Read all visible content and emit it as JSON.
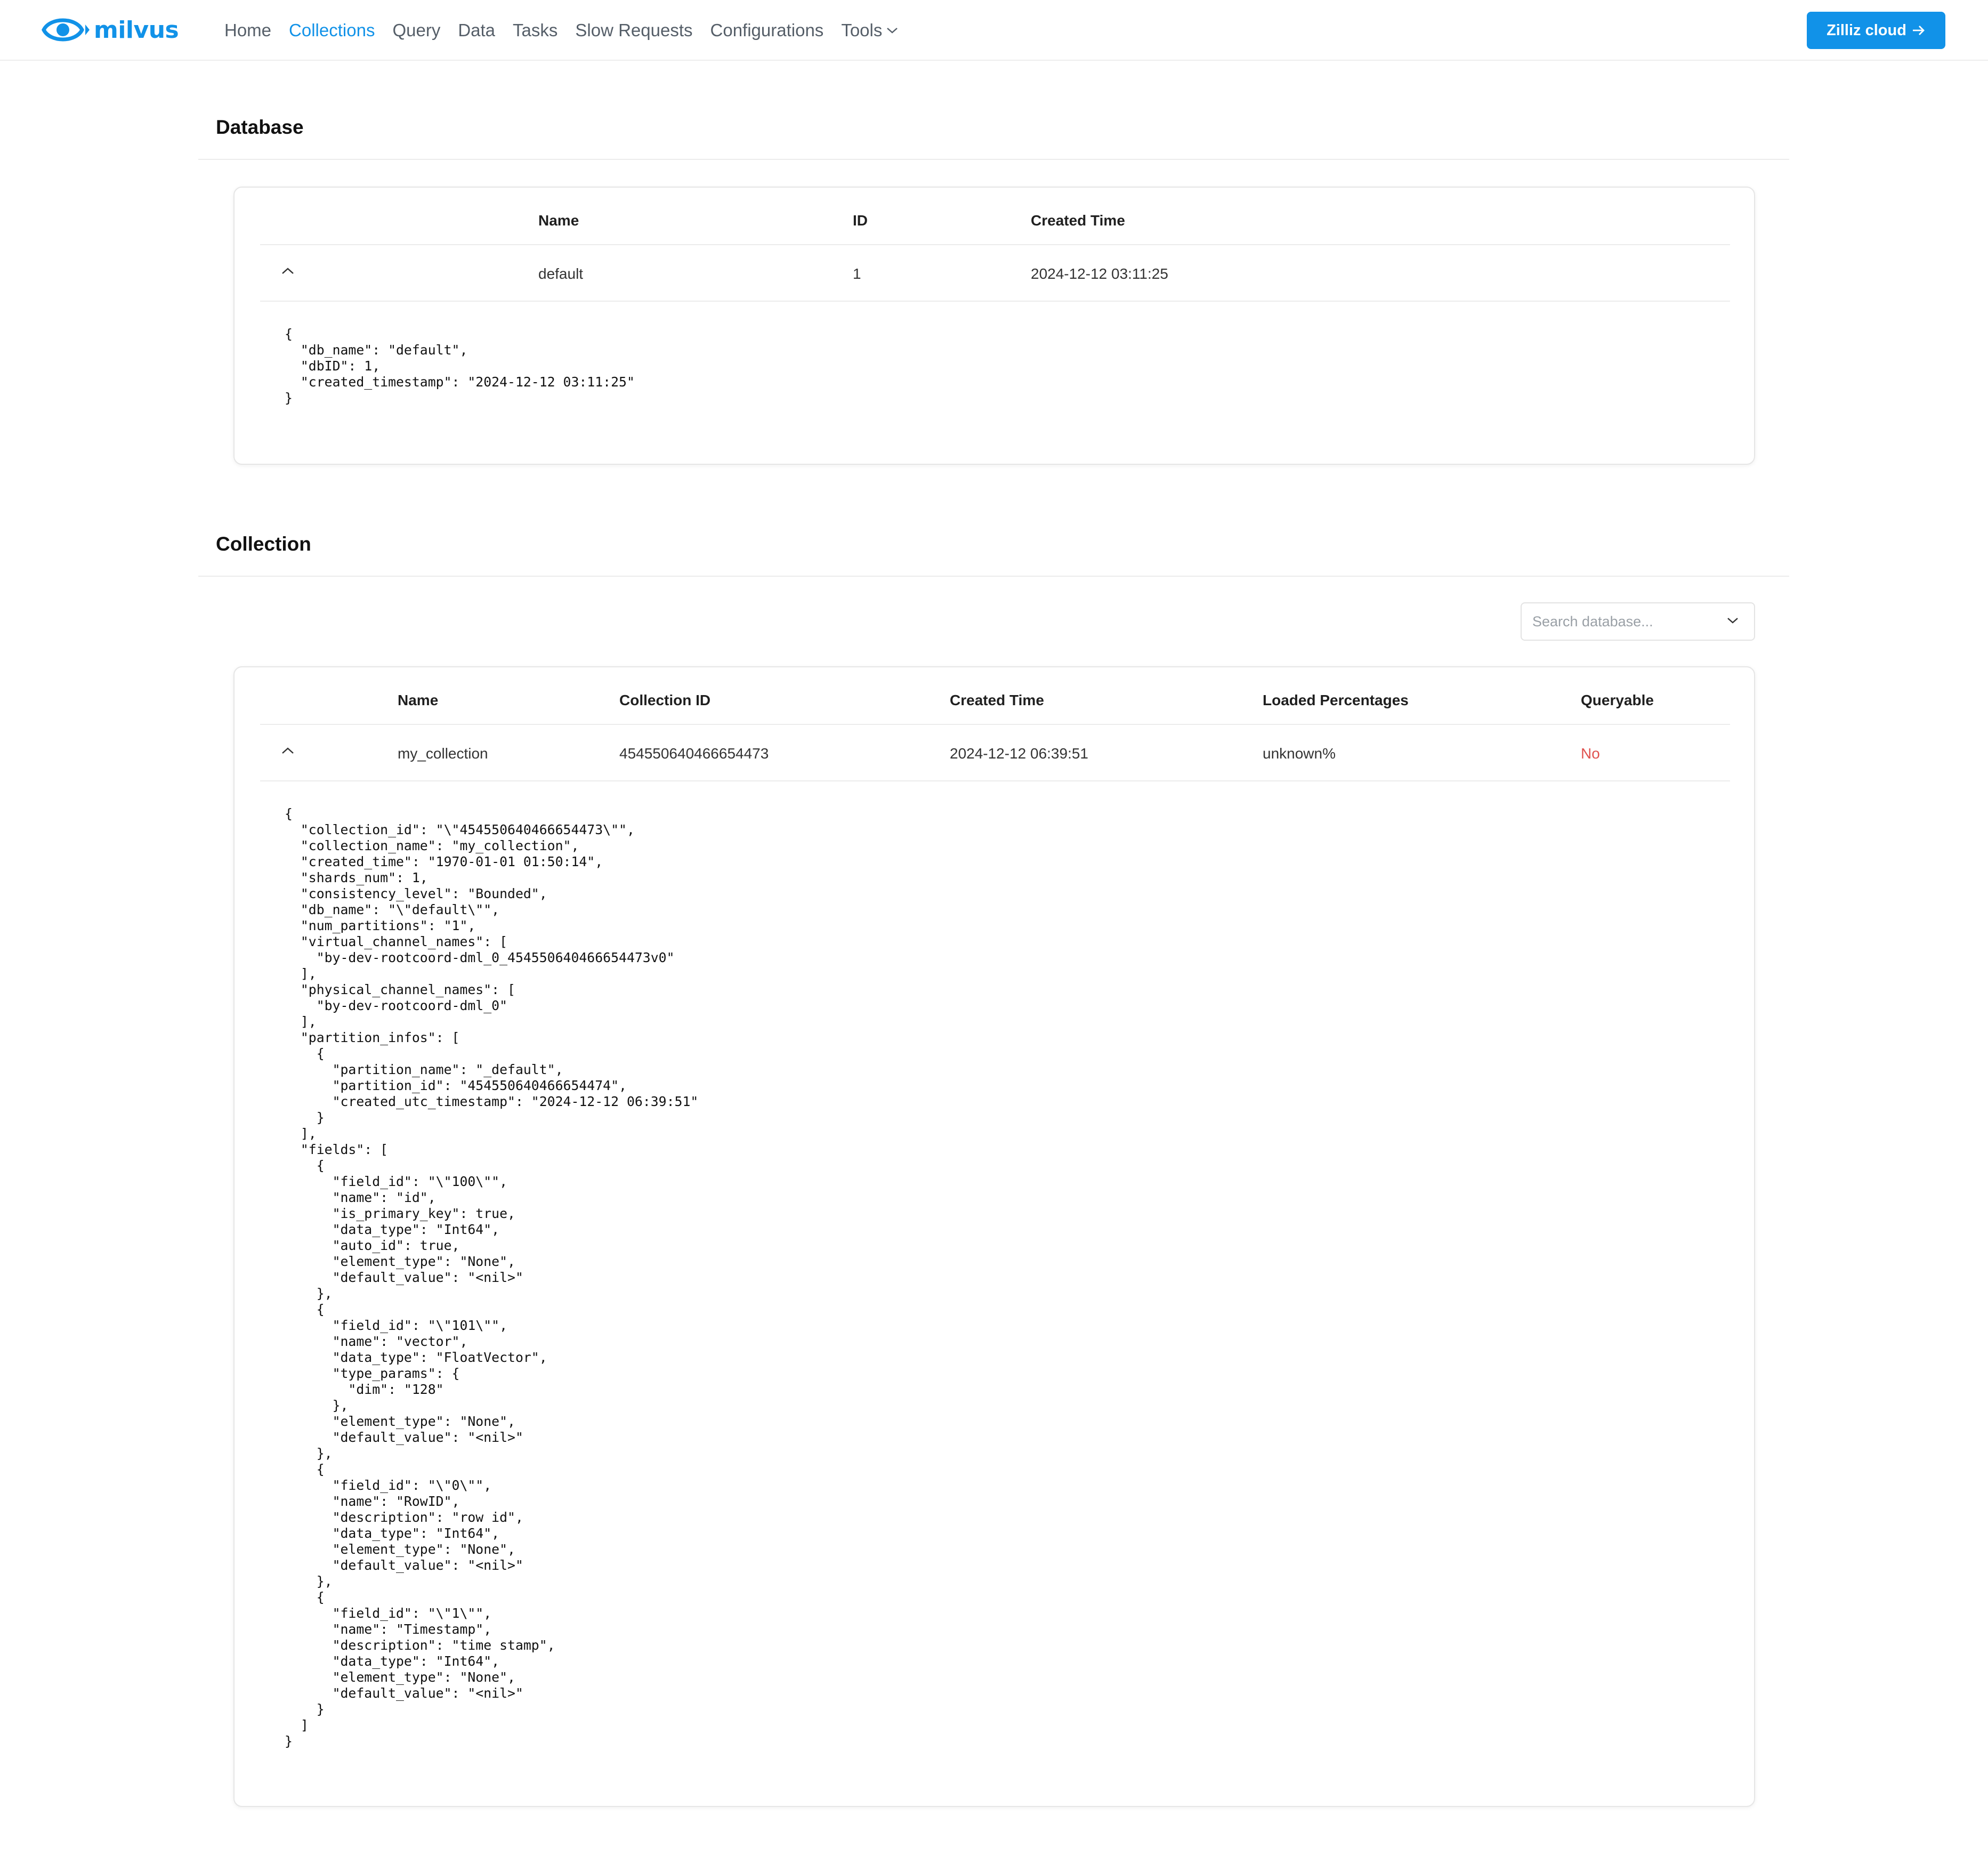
{
  "app": {
    "logo_text": "milvus"
  },
  "nav": {
    "items": [
      "Home",
      "Collections",
      "Query",
      "Data",
      "Tasks",
      "Slow Requests",
      "Configurations"
    ],
    "tools_label": "Tools",
    "active": "Collections"
  },
  "cta": {
    "label": "Zilliz cloud"
  },
  "database_section": {
    "title": "Database",
    "columns": [
      "Name",
      "ID",
      "Created Time"
    ],
    "rows": [
      {
        "name": "default",
        "id": "1",
        "created_time": "2024-12-12 03:11:25"
      }
    ],
    "detail_json": "{\n  \"db_name\": \"default\",\n  \"dbID\": 1,\n  \"created_timestamp\": \"2024-12-12 03:11:25\"\n}"
  },
  "collection_section": {
    "title": "Collection",
    "search": {
      "placeholder": "Search database..."
    },
    "columns": [
      "Name",
      "Collection ID",
      "Created Time",
      "Loaded Percentages",
      "Queryable"
    ],
    "rows": [
      {
        "name": "my_collection",
        "collection_id": "454550640466654473",
        "created_time": "2024-12-12 06:39:51",
        "loaded_percentage": "unknown%",
        "queryable": "No"
      }
    ],
    "detail_json": "{\n  \"collection_id\": \"\\\"454550640466654473\\\"\",\n  \"collection_name\": \"my_collection\",\n  \"created_time\": \"1970-01-01 01:50:14\",\n  \"shards_num\": 1,\n  \"consistency_level\": \"Bounded\",\n  \"db_name\": \"\\\"default\\\"\",\n  \"num_partitions\": \"1\",\n  \"virtual_channel_names\": [\n    \"by-dev-rootcoord-dml_0_454550640466654473v0\"\n  ],\n  \"physical_channel_names\": [\n    \"by-dev-rootcoord-dml_0\"\n  ],\n  \"partition_infos\": [\n    {\n      \"partition_name\": \"_default\",\n      \"partition_id\": \"454550640466654474\",\n      \"created_utc_timestamp\": \"2024-12-12 06:39:51\"\n    }\n  ],\n  \"fields\": [\n    {\n      \"field_id\": \"\\\"100\\\"\",\n      \"name\": \"id\",\n      \"is_primary_key\": true,\n      \"data_type\": \"Int64\",\n      \"auto_id\": true,\n      \"element_type\": \"None\",\n      \"default_value\": \"<nil>\"\n    },\n    {\n      \"field_id\": \"\\\"101\\\"\",\n      \"name\": \"vector\",\n      \"data_type\": \"FloatVector\",\n      \"type_params\": {\n        \"dim\": \"128\"\n      },\n      \"element_type\": \"None\",\n      \"default_value\": \"<nil>\"\n    },\n    {\n      \"field_id\": \"\\\"0\\\"\",\n      \"name\": \"RowID\",\n      \"description\": \"row id\",\n      \"data_type\": \"Int64\",\n      \"element_type\": \"None\",\n      \"default_value\": \"<nil>\"\n    },\n    {\n      \"field_id\": \"\\\"1\\\"\",\n      \"name\": \"Timestamp\",\n      \"description\": \"time stamp\",\n      \"data_type\": \"Int64\",\n      \"element_type\": \"None\",\n      \"default_value\": \"<nil>\"\n    }\n  ]\n}"
  },
  "colors": {
    "accent": "#1192e8",
    "negative": "#e0524f"
  },
  "icons": [
    "milvus-eye-logo-icon",
    "chevron-down-icon",
    "arrow-right-icon",
    "chevron-up-icon"
  ]
}
